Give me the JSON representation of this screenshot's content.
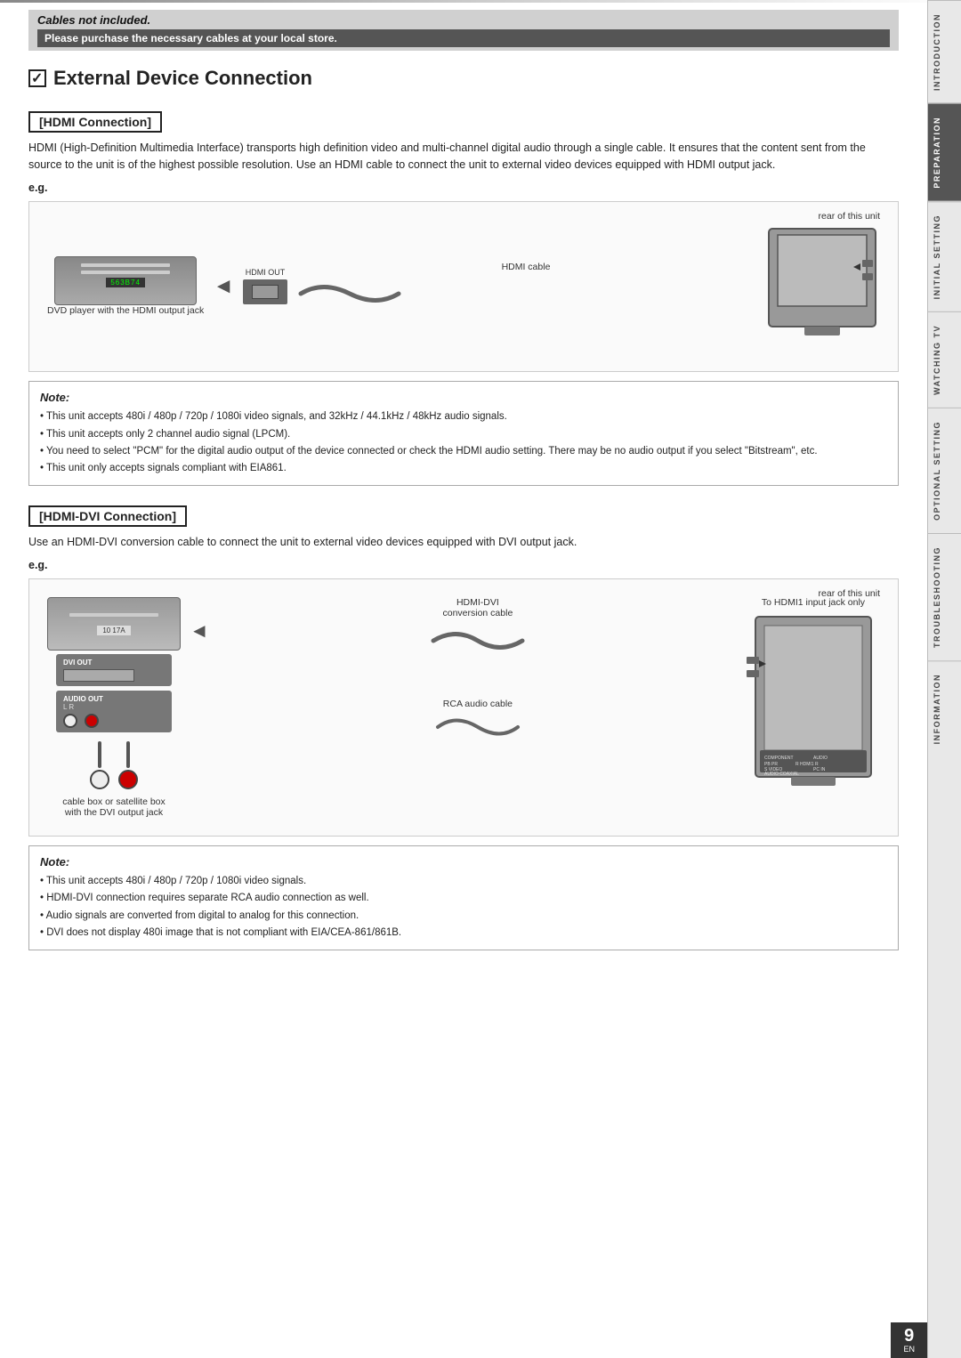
{
  "topbar": {
    "gradient": true
  },
  "sidebar": {
    "tabs": [
      {
        "label": "INTRODUCTION",
        "active": false
      },
      {
        "label": "PREPARATION",
        "active": true
      },
      {
        "label": "INITIAL SETTING",
        "active": false
      },
      {
        "label": "WATCHING TV",
        "active": false
      },
      {
        "label": "OPTIONAL SETTING",
        "active": false
      },
      {
        "label": "TROUBLESHOOTING",
        "active": false
      },
      {
        "label": "INFORMATION",
        "active": false
      }
    ]
  },
  "cables_banner": {
    "italic_text": "Cables not included.",
    "purchase_text": "Please purchase the necessary cables at your local store."
  },
  "section": {
    "title": "External Device Connection",
    "checkbox": true
  },
  "hdmi_section": {
    "title": "[HDMI Connection]",
    "body": "HDMI (High-Definition Multimedia Interface) transports high definition video and multi-channel digital audio through a single cable. It ensures that the content sent from the source to the unit is of the highest possible resolution. Use an HDMI cable to connect the unit to external video devices equipped with HDMI output jack.",
    "eg_label": "e.g.",
    "diagram_labels": {
      "rear": "rear of this unit",
      "hdmi_cable": "HDMI cable",
      "hdmi_out": "HDMI OUT",
      "dvd_caption": "DVD player with the HDMI output jack",
      "dvd_display": "563B74"
    },
    "note": {
      "title": "Note:",
      "items": [
        "This unit accepts 480i / 480p / 720p / 1080i video signals, and 32kHz / 44.1kHz / 48kHz audio signals.",
        "This unit accepts only 2 channel audio signal (LPCM).",
        "You need to select \"PCM\" for the digital audio output of the device connected or check the HDMI audio setting. There may be no audio output if you select \"Bitstream\", etc.",
        "This unit only accepts signals compliant with EIA861."
      ]
    }
  },
  "hdmi_dvi_section": {
    "title": "[HDMI-DVI Connection]",
    "body": "Use an HDMI-DVI conversion cable to connect the unit to external video devices equipped with DVI output jack.",
    "eg_label": "e.g.",
    "diagram_labels": {
      "rear": "rear of this unit",
      "hdmi_dvi_cable": "HDMI-DVI",
      "conversion_cable": "conversion cable",
      "to_hdmi1": "To HDMI1 input jack only",
      "dvi_out": "DVI OUT",
      "audio_out": "AUDIO OUT",
      "audio_lr": "L        R",
      "rca_cable": "RCA audio cable",
      "device_caption_1": "cable box or satellite box",
      "device_caption_2": "with the DVI output jack"
    },
    "note": {
      "title": "Note:",
      "items": [
        "This unit accepts 480i / 480p / 720p / 1080i video signals.",
        "HDMI-DVI connection requires separate RCA audio connection as well.",
        "Audio signals are converted from digital to analog for this connection.",
        "DVI does not display 480i image that is not compliant with EIA/CEA-861/861B."
      ]
    }
  },
  "page": {
    "number": "9",
    "lang": "EN"
  }
}
